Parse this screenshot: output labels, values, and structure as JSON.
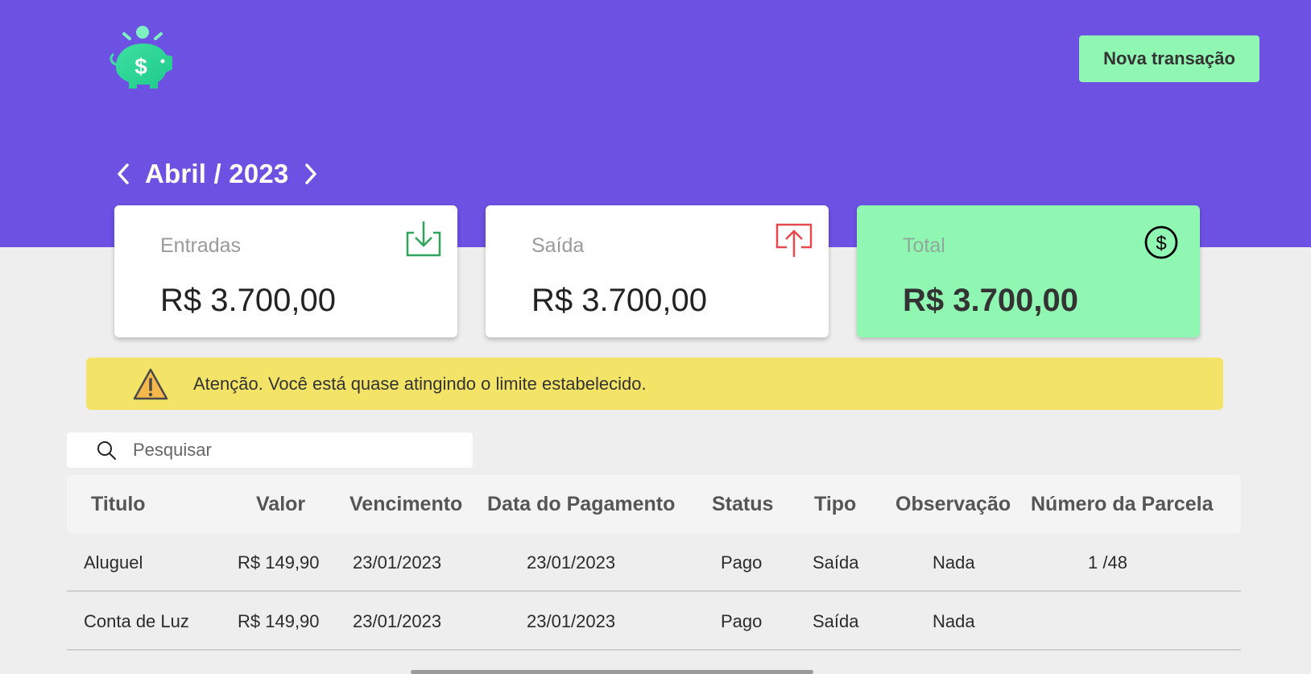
{
  "header": {
    "logo_icon": "piggy-bank-dollar-icon",
    "new_transaction_label": "Nova transação",
    "month": "Abril / 2023",
    "prev_icon": "chevron-left-icon",
    "next_icon": "chevron-right-icon"
  },
  "cards": [
    {
      "label": "Entradas",
      "value": "R$ 3.700,00",
      "icon": "download-tray-icon",
      "icon_color": "#2fa55b"
    },
    {
      "label": "Saída",
      "value": "R$ 3.700,00",
      "icon": "upload-tray-icon",
      "icon_color": "#e5484d"
    },
    {
      "label": "Total",
      "value": "R$ 3.700,00",
      "icon": "dollar-circle-icon",
      "icon_color": "#000000"
    }
  ],
  "alert": {
    "icon": "warning-triangle-icon",
    "text": "Atenção. Você está quase atingindo o limite estabelecido."
  },
  "search": {
    "placeholder": "Pesquisar",
    "value": ""
  },
  "table": {
    "columns": [
      "Titulo",
      "Valor",
      "Vencimento",
      "Data do Pagamento",
      "Status",
      "Tipo",
      "Observação",
      "Número da Parcela"
    ],
    "rows": [
      [
        "Aluguel",
        "R$ 149,90",
        "23/01/2023",
        "23/01/2023",
        "Pago",
        "Saída",
        "Nada",
        "1 /48"
      ],
      [
        "Conta de Luz",
        "R$ 149,90",
        "23/01/2023",
        "23/01/2023",
        "Pago",
        "Saída",
        "Nada",
        ""
      ]
    ]
  },
  "colors": {
    "hero": "#6c51e2",
    "accent_green": "#90f7b3",
    "alert_yellow": "#f3e467",
    "background": "#eeeeee"
  }
}
